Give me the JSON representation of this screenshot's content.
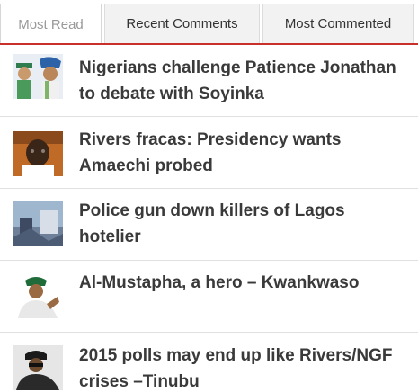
{
  "tabs": [
    {
      "label": "Most Read",
      "active": true
    },
    {
      "label": "Recent Comments",
      "active": false
    },
    {
      "label": "Most Commented",
      "active": false
    }
  ],
  "accent_color": "#c9302c",
  "articles": [
    {
      "headline": "Nigerians challenge Patience Jonathan to debate with Soyinka",
      "thumbnail_icon": "cartoon-portraits-icon"
    },
    {
      "headline": "Rivers fracas: Presidency wants Amaechi probed",
      "thumbnail_icon": "portrait-photo-icon"
    },
    {
      "headline": "Police gun down killers of Lagos hotelier",
      "thumbnail_icon": "scene-photo-icon"
    },
    {
      "headline": "Al-Mustapha, a hero – Kwankwaso",
      "thumbnail_icon": "portrait-photo-icon"
    },
    {
      "headline": "2015 polls may end up like Rivers/NGF crises –Tinubu",
      "thumbnail_icon": "portrait-photo-icon"
    }
  ]
}
